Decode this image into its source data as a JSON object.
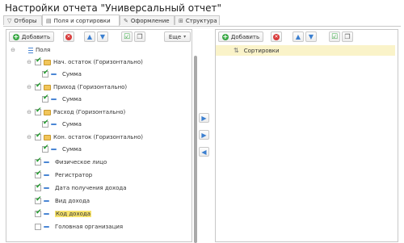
{
  "window": {
    "title": "Настройки отчета \"Универсальный отчет\""
  },
  "tabs": [
    {
      "label": "Отборы",
      "icon": "filter-icon"
    },
    {
      "label": "Поля и сортировки",
      "icon": "fields-icon"
    },
    {
      "label": "Оформление",
      "icon": "brush-icon"
    },
    {
      "label": "Структура",
      "icon": "structure-icon"
    }
  ],
  "left_toolbar": {
    "add_label": "Добавить",
    "more_label": "Еще",
    "more_arrow": "▾"
  },
  "right_toolbar": {
    "add_label": "Добавить"
  },
  "tree": {
    "root": "Поля",
    "items": [
      {
        "label": "Нач. остаток (Горизонтально)"
      },
      {
        "label": "Сумма"
      },
      {
        "label": "Приход (Горизонтально)"
      },
      {
        "label": "Сумма"
      },
      {
        "label": "Расход (Горизонтально)"
      },
      {
        "label": "Сумма"
      },
      {
        "label": "Кон. остаток (Горизонтально)"
      },
      {
        "label": "Сумма"
      },
      {
        "label": "Физическое лицо"
      },
      {
        "label": "Регистратор"
      },
      {
        "label": "Дата получения дохода"
      },
      {
        "label": "Вид дохода"
      },
      {
        "label": "Код дохода"
      },
      {
        "label": "Головная организация"
      }
    ]
  },
  "sort": {
    "icon": "sort-icon",
    "label": "Сортировки"
  }
}
